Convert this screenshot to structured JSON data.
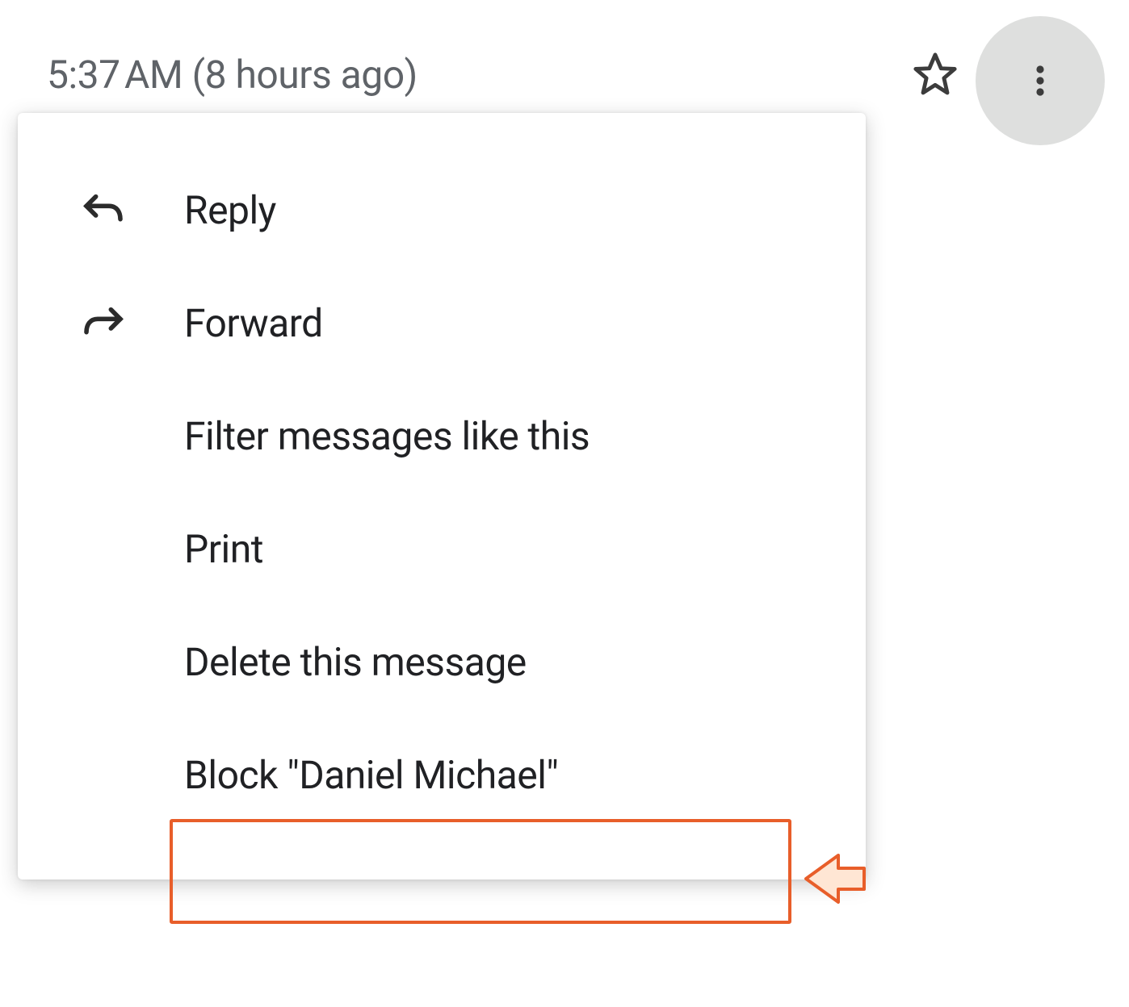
{
  "header": {
    "timestamp": "5:37 AM (8 hours ago)"
  },
  "menu": {
    "reply": "Reply",
    "forward": "Forward",
    "filter": "Filter messages like this",
    "print": "Print",
    "delete": "Delete this message",
    "block": "Block \"Daniel Michael\""
  }
}
